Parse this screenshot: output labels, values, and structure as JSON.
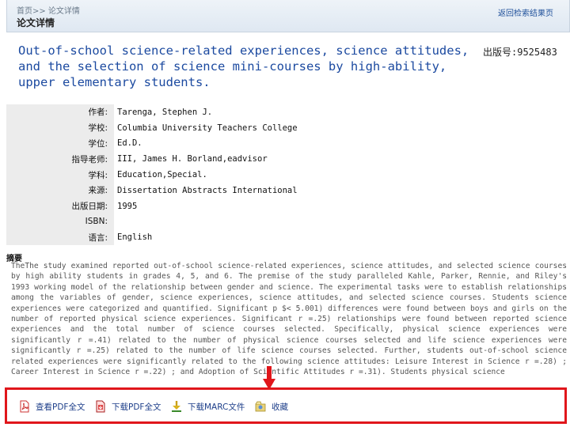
{
  "header": {
    "breadcrumb": "首页>> 论文详情",
    "title": "论文详情",
    "back_link": "返回检索结果页"
  },
  "paper": {
    "title": "Out-of-school science-related experiences, science attitudes, and the selection of science mini-courses by high-ability, upper elementary students.",
    "pub_no": "出版号:9525483"
  },
  "meta": [
    {
      "label": "作者:",
      "value": "Tarenga, Stephen J."
    },
    {
      "label": "学校:",
      "value": "Columbia University Teachers College"
    },
    {
      "label": "学位:",
      "value": "Ed.D."
    },
    {
      "label": "指导老师:",
      "value": "III, James H. Borland,eadvisor"
    },
    {
      "label": "学科:",
      "value": "Education,Special."
    },
    {
      "label": "来源:",
      "value": "Dissertation Abstracts International"
    },
    {
      "label": "出版日期:",
      "value": "1995"
    },
    {
      "label": "ISBN:",
      "value": ""
    },
    {
      "label": "语言:",
      "value": "English"
    }
  ],
  "abstract": {
    "label": "摘要",
    "text": "TheThe study examined reported out-of-school science-related experiences, science attitudes, and selected science courses by high ability students in grades 4, 5, and 6. The premise of the study paralleled Kahle, Parker, Rennie, and Riley's 1993 working model of the relationship between gender and science. The experimental tasks were to establish relationships among the variables of gender, science experiences, science attitudes, and selected science courses. Students science experiences were categorized and quantified. Significant p $< 5.001) differences were found between boys and girls on the number of reported physical science experiences. Significant r =.25) relationships were found between reported science experiences and the total number of science courses selected. Specifically, physical science experiences were significantly r =.41) related to the number of physical science courses selected and life science experiences were significantly r =.25) related to the number of life science courses selected. Further, students out-of-school science related experiences were significantly related to the following science attitudes: Leisure Interest in Science r =.28) ; Career Interest in Science r =.22) ; and Adoption of Scientific Attitudes r =.31). Students physical science"
  },
  "toolbar": {
    "view_pdf": "查看PDF全文",
    "download_pdf": "下载PDF全文",
    "download_marc": "下载MARC文件",
    "favorite": "收藏"
  },
  "colors": {
    "title_blue": "#1c4aa0",
    "highlight_red": "#e0161b",
    "label_bg": "#ececec"
  }
}
